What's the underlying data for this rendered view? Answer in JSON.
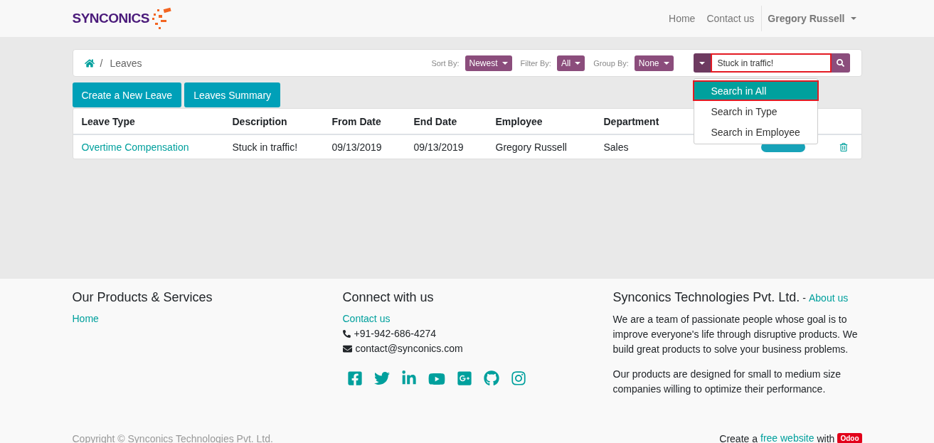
{
  "navbar": {
    "logo": "SYNCONICS",
    "links": [
      "Home",
      "Contact us"
    ],
    "user": "Gregory Russell"
  },
  "breadcrumb": {
    "separator": "/",
    "current": "Leaves"
  },
  "controls": [
    {
      "label": "Sort By:",
      "value": "Newest"
    },
    {
      "label": "Filter By:",
      "value": "All"
    },
    {
      "label": "Group By:",
      "value": "None"
    }
  ],
  "search": {
    "value": "Stuck in traffic!",
    "highlighted": true,
    "options": [
      {
        "label": "Search in All",
        "selected": true,
        "highlighted": true
      },
      {
        "label": "Search in Type",
        "selected": false,
        "highlighted": false
      },
      {
        "label": "Search in Employee",
        "selected": false,
        "highlighted": false
      }
    ]
  },
  "buttons": [
    "Create a New Leave",
    "Leaves Summary"
  ],
  "table": {
    "columns": [
      "Leave Type",
      "Description",
      "From Date",
      "End Date",
      "Employee",
      "Department"
    ],
    "rows": [
      {
        "cells": [
          "Overtime Compensation",
          "Stuck in traffic!",
          "09/13/2019",
          "09/13/2019",
          "Gregory Russell",
          "Sales"
        ]
      }
    ]
  },
  "footer": {
    "products": {
      "title": "Our Products & Services",
      "links": [
        "Home"
      ]
    },
    "connect": {
      "title": "Connect with us",
      "link": "Contact us",
      "phone": "+91-942-686-4274",
      "email": "contact@synconics.com"
    },
    "about": {
      "title": "Synconics Technologies Pvt. Ltd.",
      "separator": "-",
      "link": "About us",
      "paragraphs": [
        "We are a team of passionate people whose goal is to improve everyone's life through disruptive products. We build great products to solve your business problems.",
        "Our products are designed for small to medium size companies willing to optimize their performance."
      ]
    },
    "copyright": "Copyright © Synconics Technologies Pvt. Ltd.",
    "credit": {
      "before": "Create a",
      "link": "free website",
      "after": "with",
      "badge": "Odoo"
    }
  }
}
